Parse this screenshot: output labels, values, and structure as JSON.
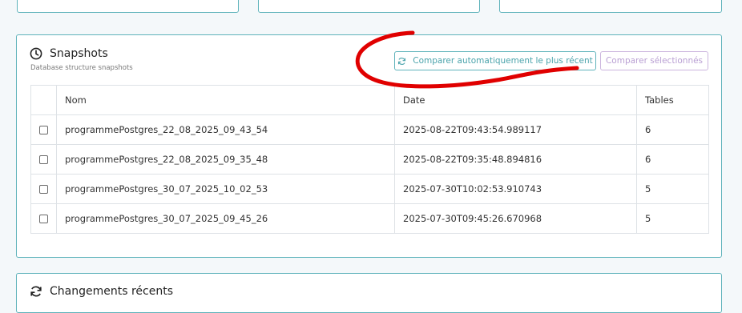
{
  "snapshots": {
    "title": "Snapshots",
    "subtitle": "Database structure snapshots",
    "compare_auto_label": "Comparer automatiquement le plus récent",
    "compare_selected_label": "Comparer sélectionnés",
    "columns": [
      "Nom",
      "Date",
      "Tables"
    ],
    "rows": [
      {
        "name": "programmePostgres_22_08_2025_09_43_54",
        "date": "2025-08-22T09:43:54.989117",
        "tables": "6"
      },
      {
        "name": "programmePostgres_22_08_2025_09_35_48",
        "date": "2025-08-22T09:35:48.894816",
        "tables": "6"
      },
      {
        "name": "programmePostgres_30_07_2025_10_02_53",
        "date": "2025-07-30T10:02:53.910743",
        "tables": "5"
      },
      {
        "name": "programmePostgres_30_07_2025_09_45_26",
        "date": "2025-07-30T09:45:26.670968",
        "tables": "5"
      }
    ]
  },
  "changes": {
    "title": "Changements récents"
  },
  "colors": {
    "accent": "#5fb3bb",
    "annotation": "#e00000",
    "disabled_button": "#b99fd3"
  },
  "icons": {
    "snapshots": "clock-icon",
    "compare_auto": "refresh-icon",
    "changes": "sync-icon"
  }
}
